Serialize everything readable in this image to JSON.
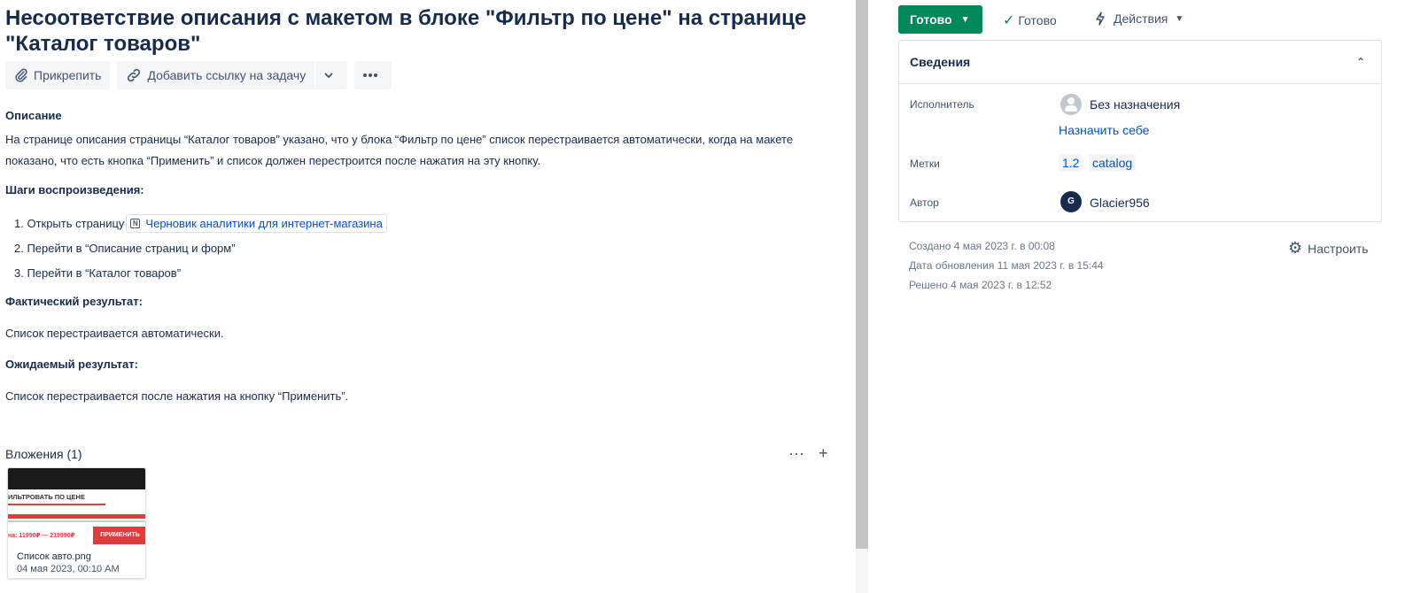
{
  "issue": {
    "title": "Несоответствие описания с макетом в блоке \"Фильтр по цене\" на странице \"Каталог товаров\""
  },
  "toolbar": {
    "attach_label": "Прикрепить",
    "link_label": "Добавить ссылку на задачу",
    "more_icon": "more-icon"
  },
  "description": {
    "heading": "Описание",
    "text": "На странице описания страницы “Каталог товаров” указано, что у блока “Фильтр по цене” список перестраивается автоматически, когда на макете показано, что есть кнопка “Применить” и список должен перестроится после нажатия на эту кнопку.",
    "steps_heading": "Шаги воспроизведения:",
    "steps": [
      {
        "text": "1. Открыть страницу",
        "link": "Черновик аналитики для интернет-магазина"
      },
      {
        "text": "2. Перейти в “Описание страниц и форм”"
      },
      {
        "text": "3. Перейти в “Каталог товаров”"
      }
    ],
    "actual_heading": "Фактический результат:",
    "actual_text": "Список перестраивается автоматически.",
    "expected_heading": "Ожидаемый результат:",
    "expected_text": "Список перестраивается после нажатия на кнопку “Применить”."
  },
  "attachments": {
    "heading": "Вложения (1)",
    "items": [
      {
        "name": "Список авто.png",
        "date": "04 мая 2023, 00:10 AM",
        "preview": {
          "filter_title": "ИЛЬТРОВАТЬ ПО ЦЕНЕ",
          "price_range": "на: 11990₽ — 219990₽",
          "apply_label": "ПРИМЕНИТЬ"
        }
      }
    ]
  },
  "sidebar": {
    "status_label": "Готово",
    "resolution_label": "Готово",
    "actions_label": "Действия",
    "details": {
      "heading": "Сведения",
      "assignee_label": "Исполнитель",
      "assignee_value": "Без назначения",
      "assign_me": "Назначить себе",
      "labels_label": "Метки",
      "labels": [
        "1.2",
        "catalog"
      ],
      "author_label": "Автор",
      "author_initial": "G",
      "author_value": "Glacier956"
    },
    "created": "Создано 4 мая 2023 г. в 00:08",
    "updated": "Дата обновления 11 мая 2023 г. в 15:44",
    "resolved": "Решено 4 мая 2023 г. в 12:52",
    "configure_label": "Настроить"
  },
  "colors": {
    "status_green": "#00875a",
    "link_blue": "#0052cc",
    "text_dark": "#172b4d",
    "preview_red": "#e03c3c"
  }
}
